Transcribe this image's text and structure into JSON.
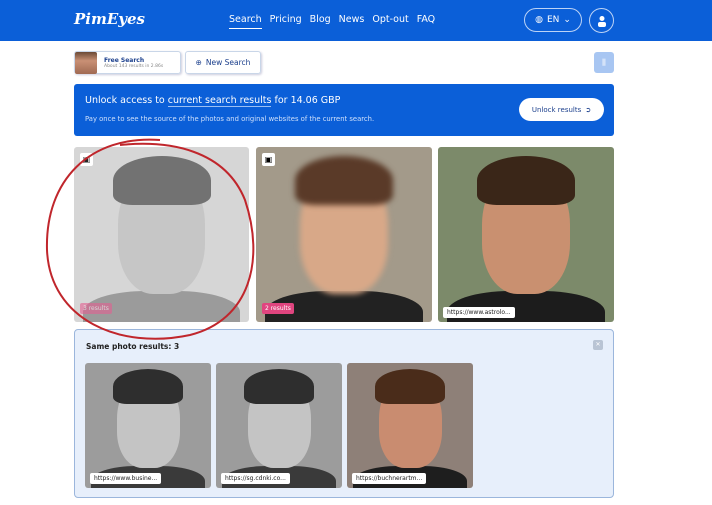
{
  "header": {
    "logo": "PimEyes",
    "nav": [
      "Search",
      "Pricing",
      "Blog",
      "News",
      "Opt-out",
      "FAQ"
    ],
    "active": "Search",
    "lang": "EN"
  },
  "toolbar": {
    "chip_title": "Free Search",
    "chip_sub": "About 143 results in 2.86s",
    "new_search": "New Search"
  },
  "banner": {
    "pre": "Unlock access to ",
    "link": "current search results",
    "post": " for 14.06 GBP",
    "sub": "Pay once to see the source of the photos and original websites of the current search.",
    "button": "Unlock results"
  },
  "results": [
    {
      "badge": "3 results"
    },
    {
      "badge": "2 results"
    },
    {
      "url": "https://www.astrolo..."
    }
  ],
  "panel": {
    "title": "Same photo results: 3",
    "items": [
      {
        "url": "https://www.busine..."
      },
      {
        "url": "https://sg.cdnki.co..."
      },
      {
        "url": "https://buchnerartm..."
      }
    ]
  },
  "colors": {
    "brand": "#0b5fd8",
    "badge": "#e0457f",
    "annotation": "#c0262c"
  }
}
